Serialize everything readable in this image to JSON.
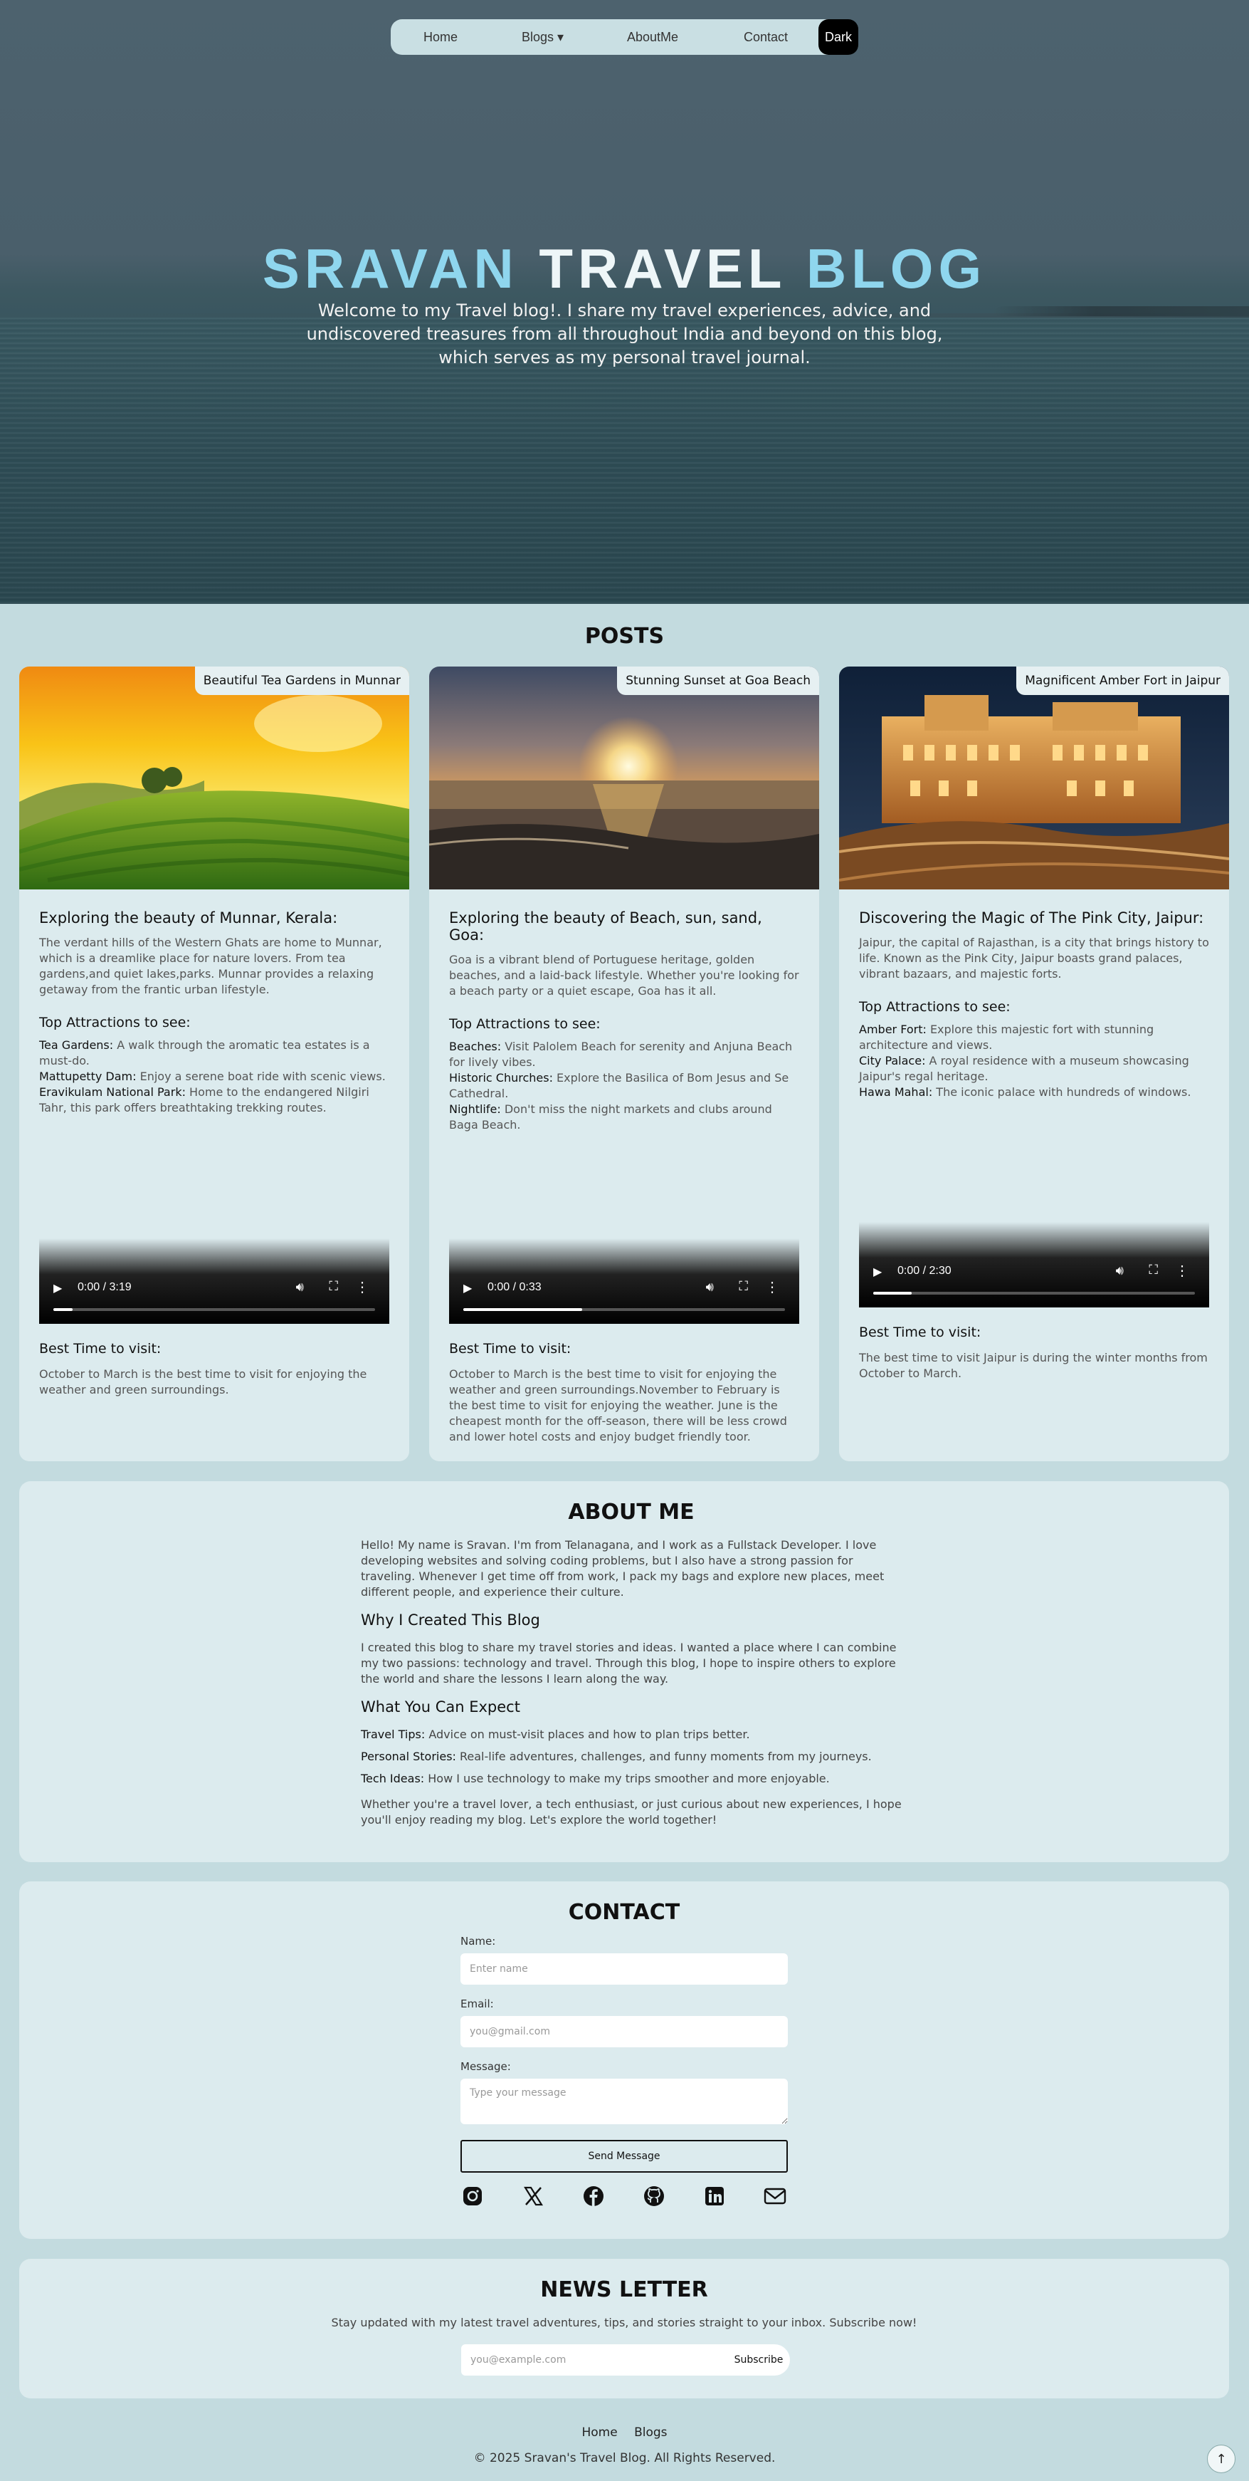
{
  "nav": {
    "home": "Home",
    "blogs": "Blogs ▾",
    "about": "AboutMe",
    "contact": "Contact",
    "theme_toggle": "Dark"
  },
  "hero": {
    "title_part1": "SRAVAN",
    "title_part2": "TRAVEL",
    "title_part3": "BLOG",
    "subtitle": "Welcome to my Travel blog!. I share my travel experiences, advice, and undiscovered treasures from all throughout India and beyond on this blog, which serves as my personal travel journal."
  },
  "posts": {
    "heading": "POSTS",
    "items": [
      {
        "image_label": "Beautiful Tea Gardens in Munnar",
        "title": "Exploring the beauty of Munnar, Kerala:",
        "description": "The verdant hills of the Western Ghats are home to Munnar, which is a dreamlike place for nature lovers. From tea gardens,and quiet lakes,parks. Munnar provides a relaxing getaway from the frantic urban lifestyle.",
        "attractions_heading": "Top Attractions to see:",
        "attractions": [
          {
            "name": "Tea Gardens:",
            "text": " A walk through the aromatic tea estates is a must-do."
          },
          {
            "name": "Mattupetty Dam:",
            "text": " Enjoy a serene boat ride with scenic views."
          },
          {
            "name": "Eravikulam National Park:",
            "text": " Home to the endangered Nilgiri Tahr, this park offers breathtaking trekking routes."
          }
        ],
        "video_time": "0:00 / 3:19",
        "video_progress": 0.06,
        "best_time_heading": "Best Time to visit:",
        "best_time": "October to March is the best time to visit for enjoying the weather and green surroundings."
      },
      {
        "image_label": "Stunning Sunset at Goa Beach",
        "title": "Exploring the beauty of Beach, sun, sand, Goa:",
        "description": "Goa is a vibrant blend of Portuguese heritage, golden beaches, and a laid-back lifestyle. Whether you're looking for a beach party or a quiet escape, Goa has it all.",
        "attractions_heading": "Top Attractions to see:",
        "attractions": [
          {
            "name": "Beaches:",
            "text": " Visit Palolem Beach for serenity and Anjuna Beach for lively vibes."
          },
          {
            "name": "Historic Churches:",
            "text": " Explore the Basilica of Bom Jesus and Se Cathedral."
          },
          {
            "name": "Nightlife:",
            "text": " Don't miss the night markets and clubs around Baga Beach."
          }
        ],
        "video_time": "0:00 / 0:33",
        "video_progress": 0.37,
        "best_time_heading": "Best Time to visit:",
        "best_time": "October to March is the best time to visit for enjoying the weather and green surroundings.November to February is the best time to visit for enjoying the weather. June is the cheapest month for the off-season, there will be less crowd and lower hotel costs and enjoy budget friendly toor."
      },
      {
        "image_label": "Magnificent Amber Fort in Jaipur",
        "title": "Discovering the Magic of The Pink City, Jaipur:",
        "description": "Jaipur, the capital of Rajasthan, is a city that brings history to life. Known as the Pink City, Jaipur boasts grand palaces, vibrant bazaars, and majestic forts.",
        "attractions_heading": "Top Attractions to see:",
        "attractions": [
          {
            "name": "Amber Fort:",
            "text": " Explore this majestic fort with stunning architecture and views."
          },
          {
            "name": "City Palace:",
            "text": " A royal residence with a museum showcasing Jaipur's regal heritage."
          },
          {
            "name": "Hawa Mahal:",
            "text": " The iconic palace with hundreds of windows."
          }
        ],
        "video_time": "0:00 / 2:30",
        "video_progress": 0.12,
        "best_time_heading": "Best Time to visit:",
        "best_time": "The best time to visit Jaipur is during the winter months from October to March."
      }
    ]
  },
  "about": {
    "heading": "ABOUT ME",
    "intro": "Hello! My name is Sravan. I'm from Telanagana, and I work as a Fullstack Developer. I love developing websites and solving coding problems, but I also have a strong passion for traveling. Whenever I get time off from work, I pack my bags and explore new places, meet different people, and experience their culture.",
    "why_heading": "Why I Created This Blog",
    "why_text": "I created this blog to share my travel stories and ideas. I wanted a place where I can combine my two passions: technology and travel. Through this blog, I hope to inspire others to explore the world and share the lessons I learn along the way.",
    "expect_heading": "What You Can Expect",
    "expect_items": [
      {
        "name": "Travel Tips:",
        "text": " Advice on must-visit places and how to plan trips better."
      },
      {
        "name": "Personal Stories:",
        "text": " Real-life adventures, challenges, and funny moments from my journeys."
      },
      {
        "name": "Tech Ideas:",
        "text": " How I use technology to make my trips smoother and more enjoyable."
      }
    ],
    "closing": "Whether you're a travel lover, a tech enthusiast, or just curious about new experiences, I hope you'll enjoy reading my blog. Let's explore the world together!"
  },
  "contact": {
    "heading": "CONTACT",
    "name_label": "Name:",
    "name_placeholder": "Enter name",
    "email_label": "Email:",
    "email_placeholder": "you@gmail.com",
    "message_label": "Message:",
    "message_placeholder": "Type your message",
    "send_label": "Send Message",
    "socials": [
      "instagram-icon",
      "x-icon",
      "facebook-icon",
      "github-icon",
      "linkedin-icon",
      "mail-icon"
    ]
  },
  "newsletter": {
    "heading": "NEWS LETTER",
    "text": "Stay updated with my latest travel adventures, tips, and stories straight to your inbox. Subscribe now!",
    "email_placeholder": "you@example.com",
    "subscribe_label": "Subscribe"
  },
  "footer": {
    "link_home": "Home",
    "link_blogs": "Blogs",
    "copyright": "© 2025 Sravan's Travel Blog. All Rights Reserved.",
    "to_top": "↑"
  },
  "colors": {
    "page_bg": "#c3dbdf",
    "panel_bg": "#dcebee",
    "title_accent": "#8fd6ee"
  }
}
